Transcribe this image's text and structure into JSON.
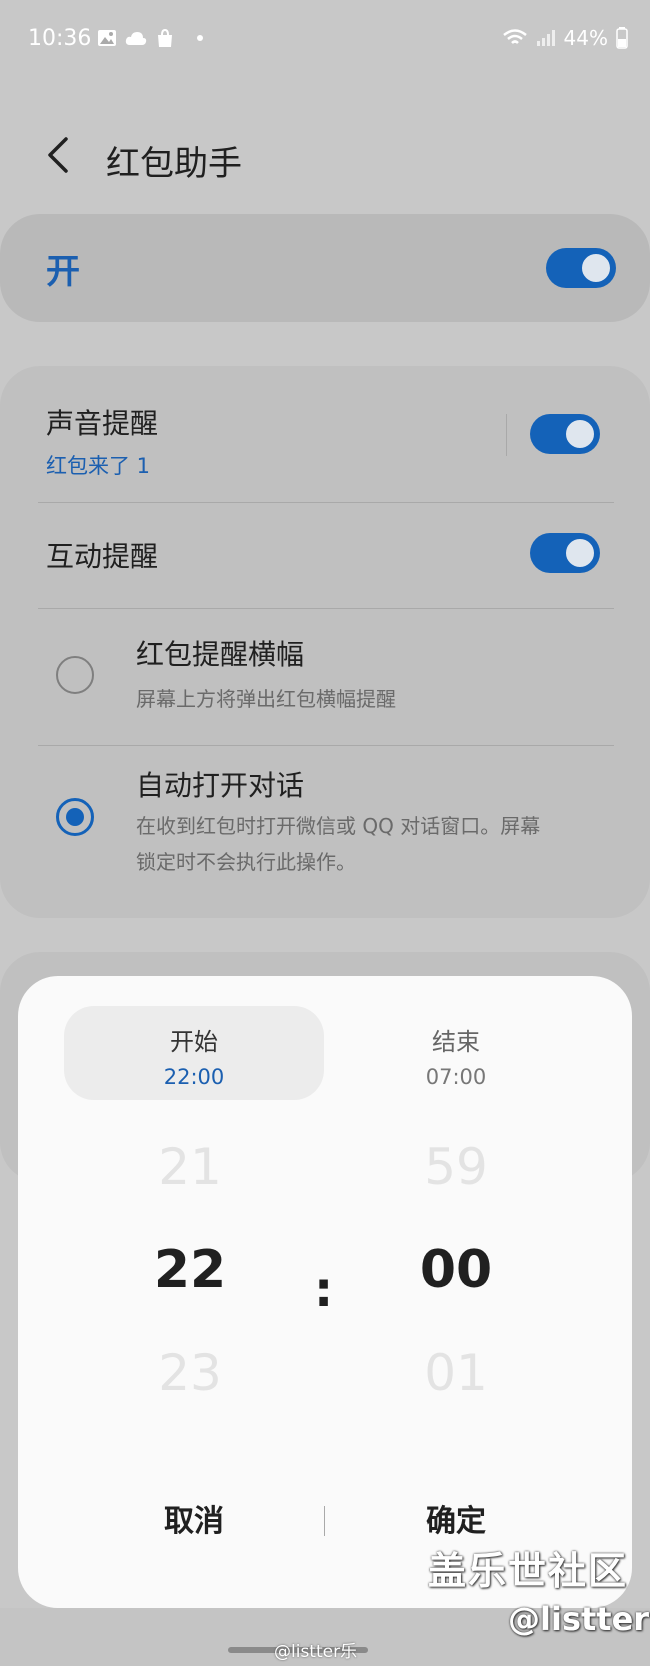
{
  "status_bar": {
    "time": "10:36",
    "battery": "44%",
    "left_icons": [
      "gallery-icon",
      "cloud-icon",
      "shopping-bag-icon",
      "dot-icon"
    ],
    "right_icons": [
      "wifi-icon",
      "signal-icon",
      "battery-icon"
    ]
  },
  "header": {
    "title": "红包助手"
  },
  "master": {
    "label": "开",
    "enabled": true
  },
  "settings": {
    "sound": {
      "title": "声音提醒",
      "subtitle": "红包来了 1",
      "enabled": true
    },
    "interaction": {
      "title": "互动提醒",
      "enabled": true
    },
    "banner": {
      "title": "红包提醒横幅",
      "desc": "屏幕上方将弹出红包横幅提醒",
      "selected": false
    },
    "auto_open": {
      "title": "自动打开对话",
      "desc_line1": "在收到红包时打开微信或 QQ 对话窗口。屏幕",
      "desc_line2": "锁定时不会执行此操作。",
      "selected": true
    }
  },
  "dialog": {
    "start": {
      "label": "开始",
      "time": "22:00"
    },
    "end": {
      "label": "结束",
      "time": "07:00"
    },
    "hours": {
      "prev": "21",
      "current": "22",
      "next": "23"
    },
    "minutes": {
      "prev": "59",
      "current": "00",
      "next": "01"
    },
    "separator": ":",
    "cancel_label": "取消",
    "confirm_label": "确定"
  },
  "watermark": {
    "site": "盖乐世社区",
    "handle": "@listter",
    "weibo": "@listter乐"
  },
  "colors": {
    "accent": "#1462b8",
    "accent_text": "#1b5fb0",
    "background": "#c8c8c8",
    "dialog_bg": "#fafafa"
  }
}
